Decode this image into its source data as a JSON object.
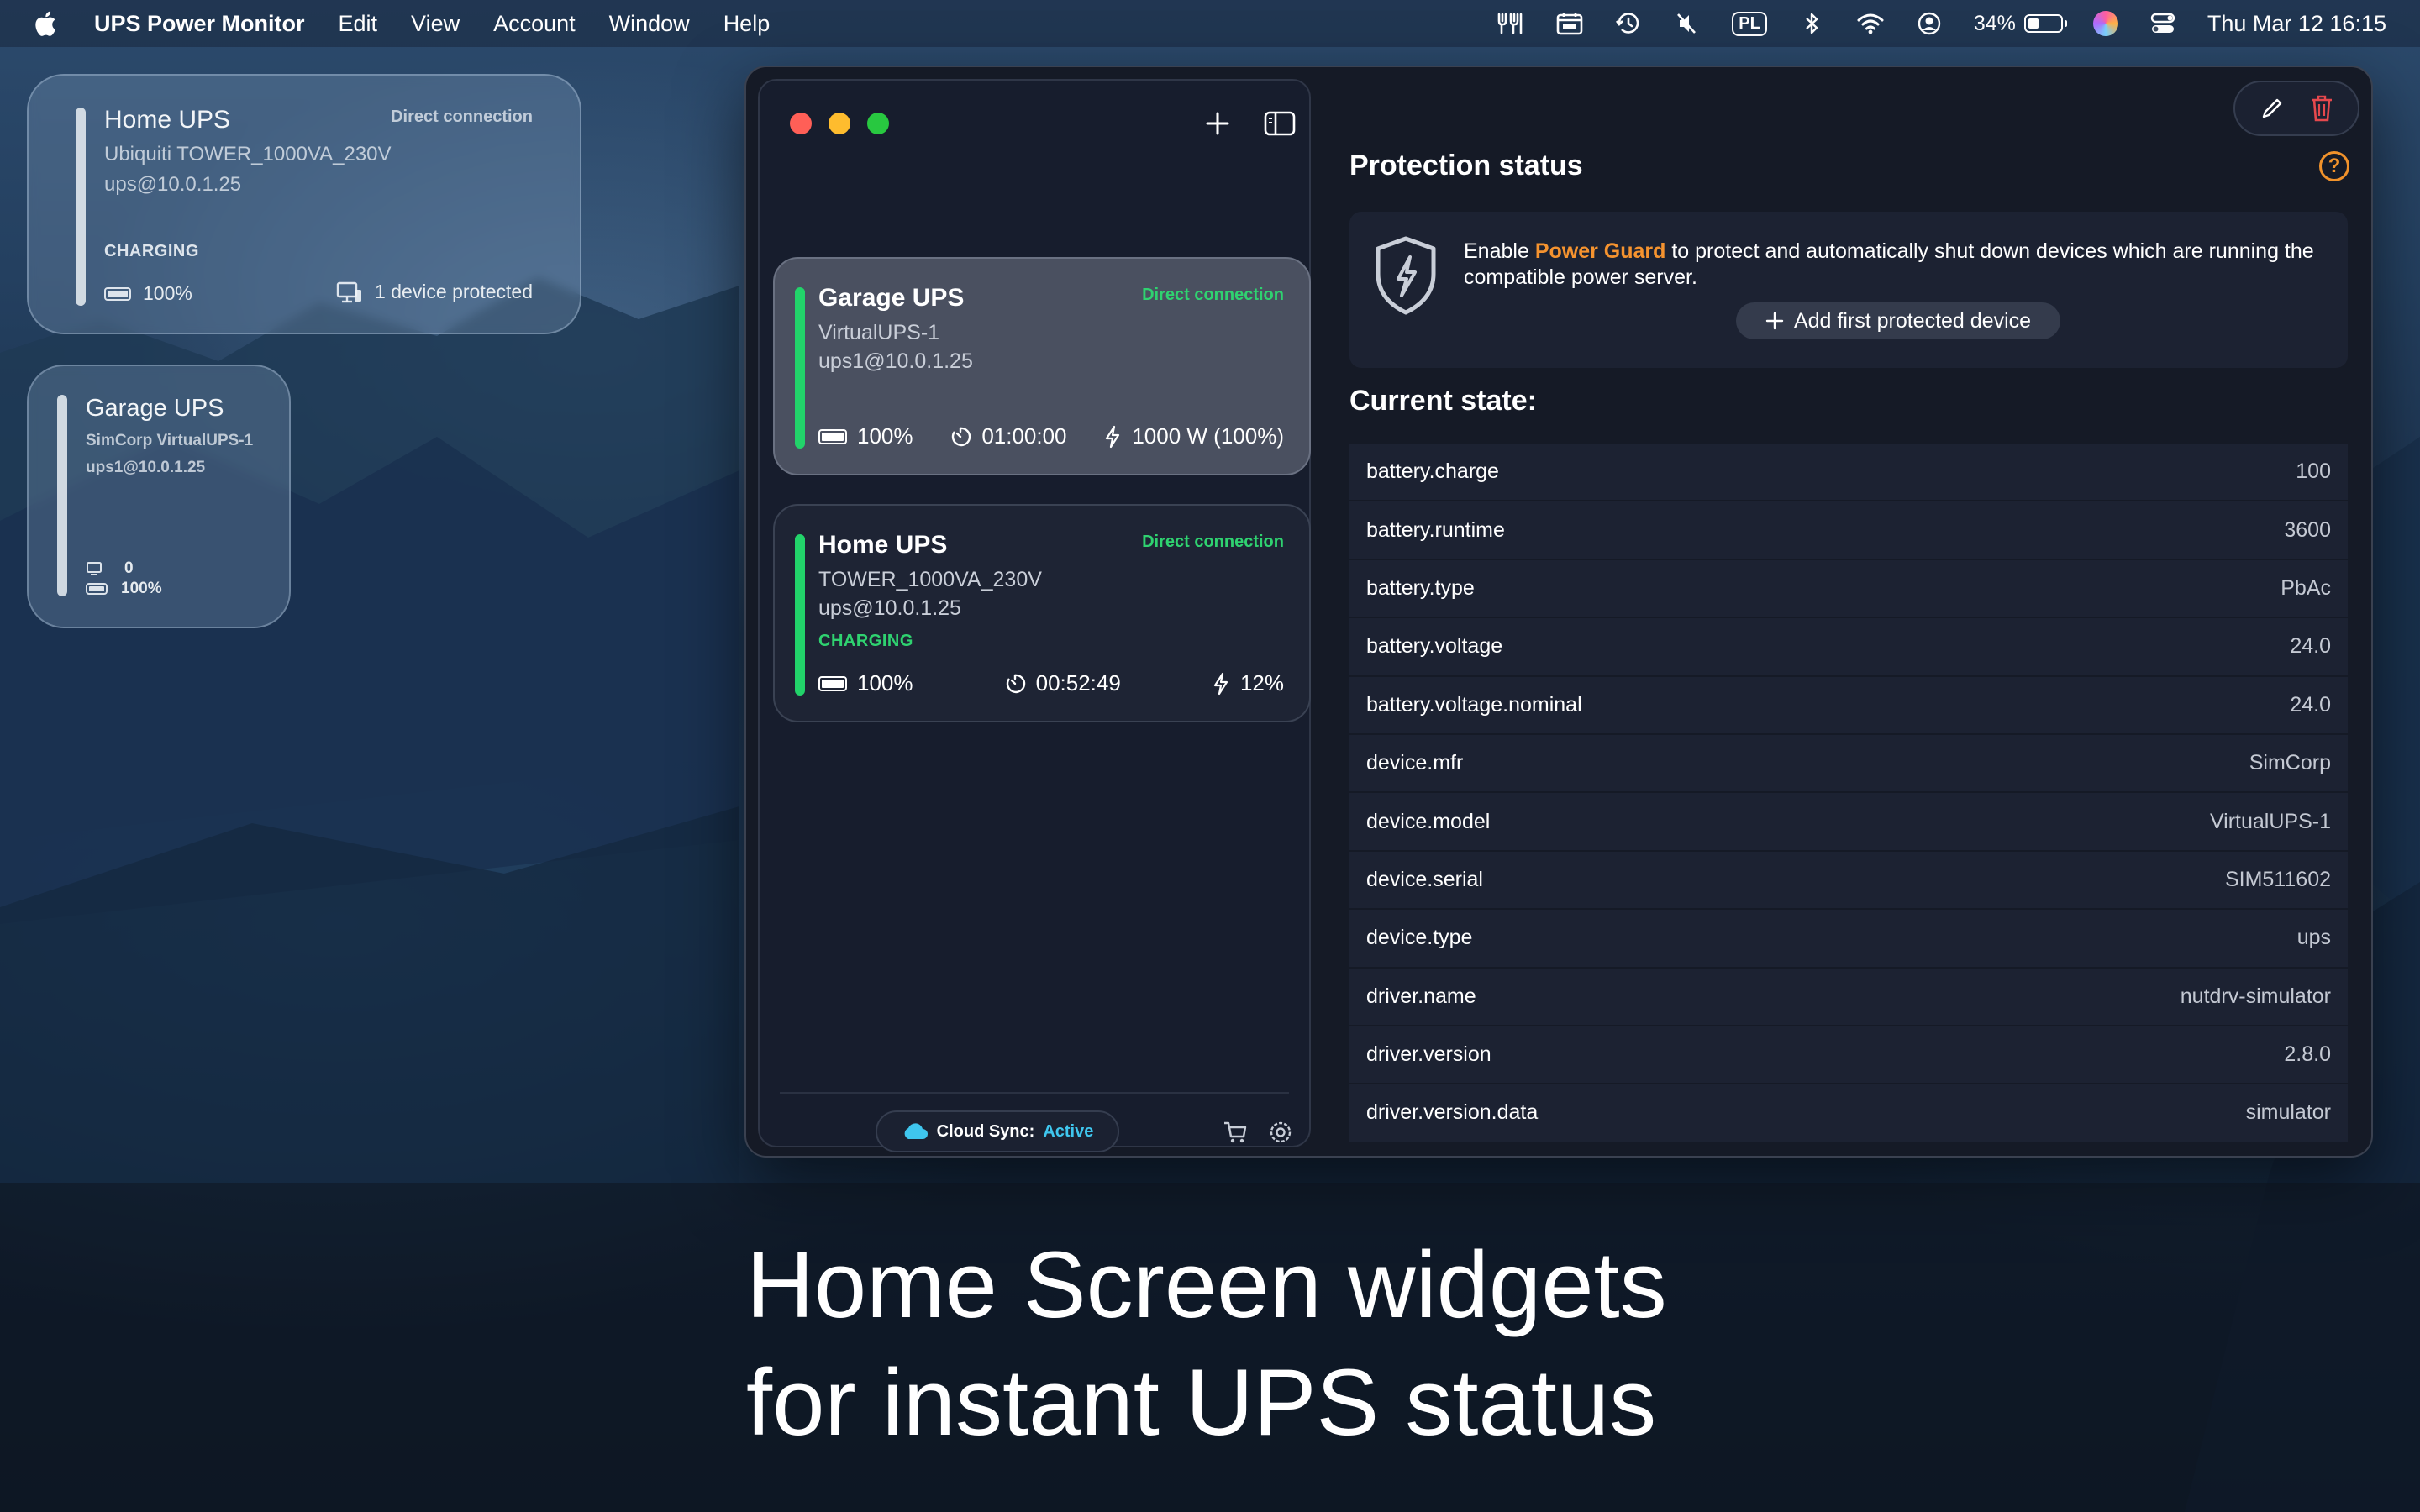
{
  "menubar": {
    "app_name": "UPS Power Monitor",
    "menus": [
      "Edit",
      "View",
      "Account",
      "Window",
      "Help"
    ],
    "input_source": "PL",
    "battery_percent": "34%",
    "battery_level": 0.34,
    "datetime": "Thu Mar 12  16:15"
  },
  "widgets": {
    "home": {
      "title": "Home UPS",
      "connection": "Direct connection",
      "model": "Ubiquiti TOWER_1000VA_230V",
      "address": "ups@10.0.1.25",
      "status": "CHARGING",
      "battery": "100%",
      "devices": "1 device protected"
    },
    "garage": {
      "title": "Garage UPS",
      "model": "SimCorp VirtualUPS-1",
      "address": "ups1@10.0.1.25",
      "devices": "0",
      "battery": "100%"
    }
  },
  "sidebar": {
    "cards": [
      {
        "title": "Garage UPS",
        "connection": "Direct connection",
        "model": "VirtualUPS-1",
        "address": "ups1@10.0.1.25",
        "battery": "100%",
        "runtime": "01:00:00",
        "load": "1000 W (100%)"
      },
      {
        "title": "Home UPS",
        "connection": "Direct connection",
        "model": "TOWER_1000VA_230V",
        "address": "ups@10.0.1.25",
        "status": "CHARGING",
        "battery": "100%",
        "runtime": "00:52:49",
        "load": "12%"
      }
    ],
    "cloud_sync_label": "Cloud Sync:",
    "cloud_sync_state": "Active"
  },
  "main": {
    "protection_title": "Protection status",
    "guard_prefix": "Enable",
    "guard_name": "Power Guard",
    "guard_suffix": "to protect and automatically shut down devices which are running the compatible power server.",
    "add_button": "Add first protected device",
    "state_title": "Current state:",
    "state_rows": [
      {
        "key": "battery.charge",
        "value": "100"
      },
      {
        "key": "battery.runtime",
        "value": "3600"
      },
      {
        "key": "battery.type",
        "value": "PbAc"
      },
      {
        "key": "battery.voltage",
        "value": "24.0"
      },
      {
        "key": "battery.voltage.nominal",
        "value": "24.0"
      },
      {
        "key": "device.mfr",
        "value": "SimCorp"
      },
      {
        "key": "device.model",
        "value": "VirtualUPS-1"
      },
      {
        "key": "device.serial",
        "value": "SIM511602"
      },
      {
        "key": "device.type",
        "value": "ups"
      },
      {
        "key": "driver.name",
        "value": "nutdrv-simulator"
      },
      {
        "key": "driver.version",
        "value": "2.8.0"
      },
      {
        "key": "driver.version.data",
        "value": "simulator"
      }
    ]
  },
  "headline": {
    "line1": "Home Screen widgets",
    "line2": "for instant UPS status"
  },
  "colors": {
    "accent_green": "#22d36a",
    "power_guard_orange": "#f5932f",
    "cloud_active": "#3fc6ee",
    "delete_red": "#e5484d"
  }
}
